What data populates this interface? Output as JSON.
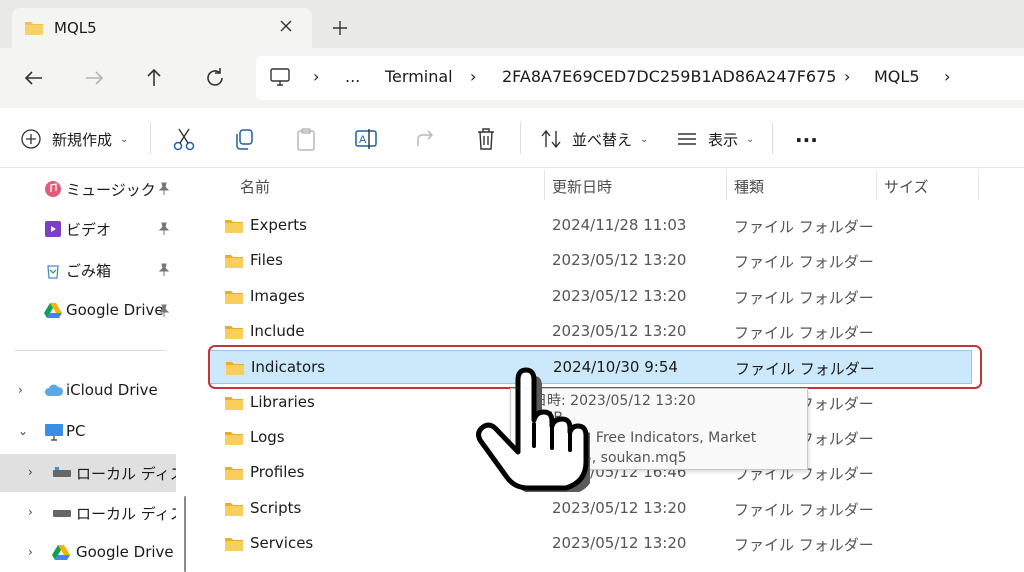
{
  "tab": {
    "title": "MQL5"
  },
  "address": {
    "segments": [
      "Terminal",
      "2FA8A7E69CED7DC259B1AD86A247F675",
      "MQL5"
    ],
    "more": "..."
  },
  "commands": {
    "new": "新規作成",
    "sort": "並べ替え",
    "view": "表示",
    "more": "..."
  },
  "sidebar": {
    "quick": [
      {
        "label": "ミュージック"
      },
      {
        "label": "ビデオ"
      },
      {
        "label": "ごみ箱"
      },
      {
        "label": "Google Drive"
      }
    ],
    "icloud": "iCloud Drive",
    "pc": "PC",
    "drives": [
      {
        "label": "ローカル ディスク ("
      },
      {
        "label": "ローカル ディスク ("
      },
      {
        "label": "Google Drive ("
      }
    ]
  },
  "columns": {
    "name": "名前",
    "date": "更新日時",
    "type": "種類",
    "size": "サイズ"
  },
  "files": [
    {
      "name": "Experts",
      "date": "2024/11/28 11:03",
      "type": "ファイル フォルダー"
    },
    {
      "name": "Files",
      "date": "2023/05/12 13:20",
      "type": "ファイル フォルダー"
    },
    {
      "name": "Images",
      "date": "2023/05/12 13:20",
      "type": "ファイル フォルダー"
    },
    {
      "name": "Include",
      "date": "2023/05/12 13:20",
      "type": "ファイル フォルダー"
    },
    {
      "name": "Indicators",
      "date": "2024/10/30 9:54",
      "type": "ファイル フォルダー"
    },
    {
      "name": "Libraries",
      "date": "",
      "type": "ファイル フォルダー"
    },
    {
      "name": "Logs",
      "date": "",
      "type": "ファイル フォルダー"
    },
    {
      "name": "Profiles",
      "date": "2023/05/12 16:46",
      "type": "ファイル フォルダー"
    },
    {
      "name": "Scripts",
      "date": "2023/05/12 13:20",
      "type": "ファイル フォルダー"
    },
    {
      "name": "Services",
      "date": "2023/05/12 13:20",
      "type": "ファイル フォルダー"
    }
  ],
  "tooltip": {
    "line1": "成日時: 2023/05/12 13:20",
    "line2": "66 MB",
    "line3": "Examples, Free Indicators, Market",
    "line4": "oukan.ex5, soukan.mq5"
  },
  "colors": {
    "accent": "#c4343c",
    "selection": "#cce8fb",
    "folder": "#f2c14e"
  }
}
